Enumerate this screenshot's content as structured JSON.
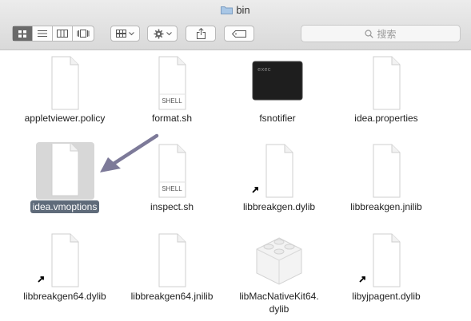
{
  "window": {
    "title": "bin"
  },
  "toolbar": {
    "views": [
      "icon-view",
      "list-view",
      "column-view",
      "cover-flow-view"
    ],
    "search_placeholder": "搜索"
  },
  "files": [
    {
      "name": "appletviewer.policy",
      "kind": "document"
    },
    {
      "name": "format.sh",
      "kind": "shell",
      "tag": "SHELL"
    },
    {
      "name": "fsnotifier",
      "kind": "exec",
      "tag": "exec"
    },
    {
      "name": "idea.properties",
      "kind": "document"
    },
    {
      "name": "idea.vmoptions",
      "kind": "document",
      "selected": true
    },
    {
      "name": "inspect.sh",
      "kind": "shell",
      "tag": "SHELL"
    },
    {
      "name": "libbreakgen.dylib",
      "kind": "alias"
    },
    {
      "name": "libbreakgen.jnilib",
      "kind": "document"
    },
    {
      "name": "libbreakgen64.dylib",
      "kind": "alias"
    },
    {
      "name": "libbreakgen64.jnilib",
      "kind": "document"
    },
    {
      "name": "libMacNativeKit64.dylib",
      "line1": "libMacNativeKit64.",
      "line2": "dylib",
      "kind": "bundle"
    },
    {
      "name": "libyjpagent.dylib",
      "kind": "alias"
    }
  ],
  "colors": {
    "selection": "#5f6b7a",
    "arrow": "#7d7a99",
    "active_segment": "#6a6a6a"
  }
}
